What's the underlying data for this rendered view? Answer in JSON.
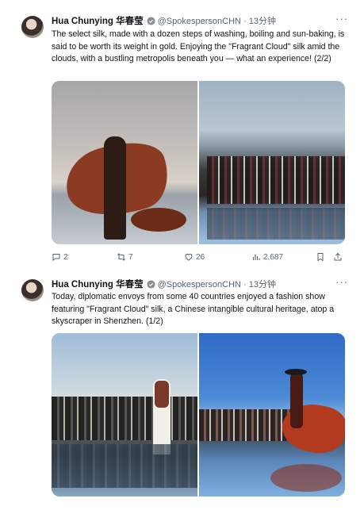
{
  "tweets": [
    {
      "author": "Hua Chunying 华春莹",
      "handle": "@SpokespersonCHN · 13分钟",
      "more": "···",
      "text": "The select silk, made with a dozen steps of washing, boiling and sun-baking, is said to be worth its weight in gold. Enjoying the \"Fragrant Cloud\" silk amid the clouds, with a bustling metropolis beneath you — what an experience!  (2/2)",
      "stats": {
        "replies": "2",
        "retweets": "7",
        "likes": "26",
        "views": "2,687"
      }
    },
    {
      "author": "Hua Chunying 华春莹",
      "handle": "@SpokespersonCHN · 13分钟",
      "more": "···",
      "text": "Today, diplomatic envoys from some 40 countries enjoyed a fashion show featuring \"Fragrant Cloud\" silk, a Chinese intangible cultural heritage, atop a skyscraper in Shenzhen.  (1/2)"
    }
  ],
  "colors": {
    "verified": "#1d9bf0",
    "secondary_text": "#536471",
    "primary_text": "#0f1419"
  },
  "icons": [
    "verified-badge-icon",
    "reply-icon",
    "retweet-icon",
    "like-icon",
    "views-icon",
    "bookmark-icon",
    "share-icon",
    "more-icon"
  ]
}
